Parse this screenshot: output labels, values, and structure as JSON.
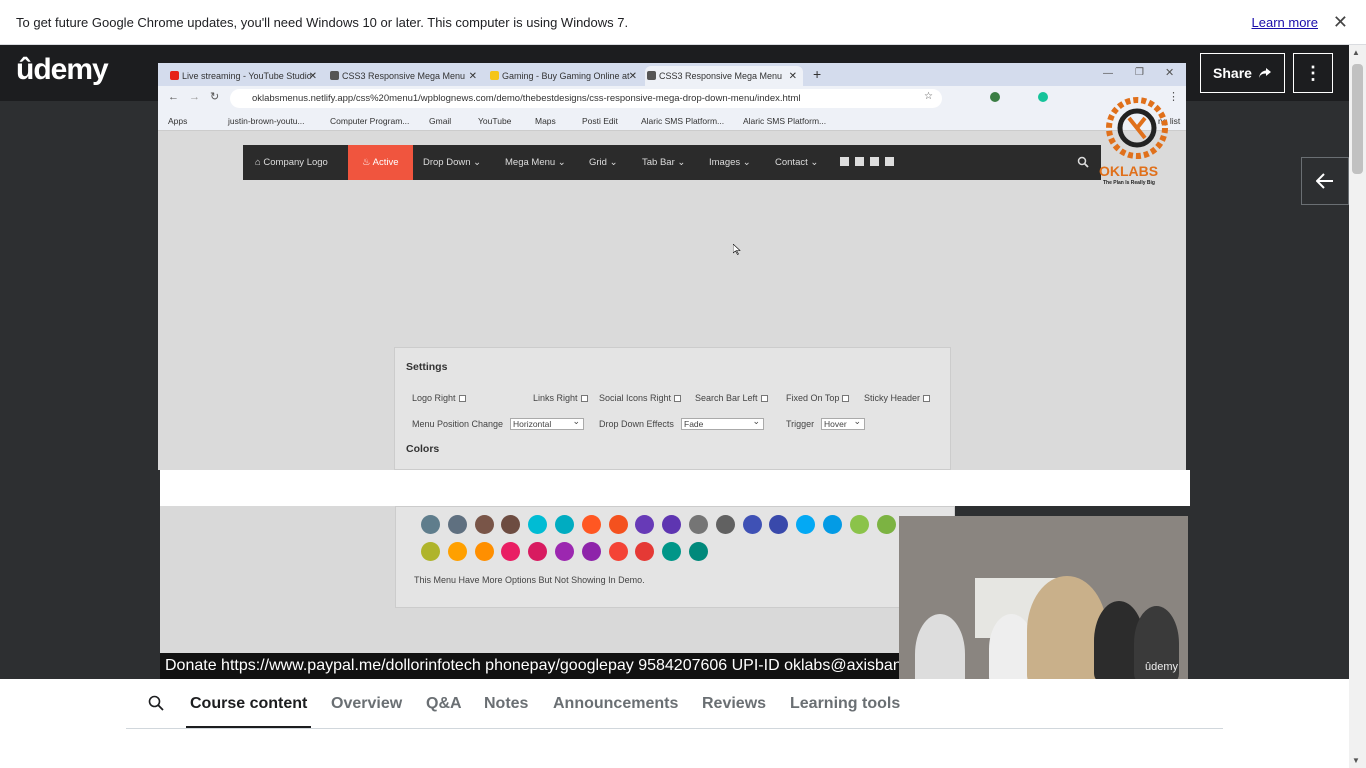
{
  "chrome_notice": {
    "message": "To get future Google Chrome updates, you'll need Windows 10 or later. This computer is using Windows 7.",
    "learn_more": "Learn more",
    "close": "✕"
  },
  "udemy": {
    "logo": "ûdemy",
    "share_label": "Share",
    "more_label": "⋮"
  },
  "inner_browser": {
    "tabs": [
      {
        "title": "Live streaming - YouTube Studio",
        "color": "#e62117"
      },
      {
        "title": "CSS3 Responsive Mega Menu",
        "color": "#555555"
      },
      {
        "title": "Gaming - Buy Gaming Online at",
        "color": "#f5c518"
      },
      {
        "title": "CSS3 Responsive Mega Menu",
        "color": "#555555"
      }
    ],
    "url": "oklabsmenus.netlify.app/css%20menu1/wpblognews.com/demo/thebestdesigns/css-responsive-mega-drop-down-menu/index.html",
    "bookmarks": [
      "Apps",
      "justin-brown-youtu...",
      "Computer Program...",
      "Gmail",
      "YouTube",
      "Maps",
      "Posti Edit",
      "Alaric SMS Platform...",
      "Alaric SMS Platform..."
    ],
    "reading_list": "ng list"
  },
  "site_nav": {
    "logo": "Company Logo",
    "active": "Active",
    "items": [
      "Drop Down ⌄",
      "Mega Menu ⌄",
      "Grid ⌄",
      "Tab Bar ⌄",
      "Images ⌄",
      "Contact ⌄"
    ]
  },
  "settings": {
    "title": "Settings",
    "checkboxes": [
      "Logo Right",
      "Links Right",
      "Social Icons Right",
      "Search Bar Left",
      "Fixed On Top",
      "Sticky Header"
    ],
    "menu_position_label": "Menu Position Change",
    "menu_position_value": "Horizontal",
    "drop_down_label": "Drop Down Effects",
    "drop_down_value": "Fade",
    "trigger_label": "Trigger",
    "trigger_value": "Hover",
    "colors_title": "Colors"
  },
  "colors": {
    "row1": [
      "#5f7d8c",
      "#5f7080",
      "#795548",
      "#6d4c41",
      "#00bcd4",
      "#00acc1",
      "#ff5722",
      "#f4511e",
      "#673ab7",
      "#5e35b1",
      "#757575",
      "#616161",
      "#3f51b5",
      "#3949ab",
      "#03a9f4",
      "#039be5",
      "#8bc34a",
      "#7cb342"
    ],
    "row2": [
      "#afb42b",
      "#ffa000",
      "#ff8f00",
      "#e91e63",
      "#d81b60",
      "#9c27b0",
      "#8e24aa",
      "#f44336",
      "#e53935",
      "#009688",
      "#00897b"
    ],
    "note": "This Menu Have More Options But Not Showing In Demo."
  },
  "oklabs_logo": {
    "name": "OKLABS",
    "tagline": "The Plan Is Really Big"
  },
  "webcam": {
    "watermark": "ûdemy"
  },
  "donate_banner": "Donate https://www.paypal.me/dollorinfotech phonepay/googlepay 9584207606 UPI-ID oklabs@axisbank",
  "course_tabs": {
    "items": [
      "Course content",
      "Overview",
      "Q&A",
      "Notes",
      "Announcements",
      "Reviews",
      "Learning tools"
    ],
    "active": "Course content"
  }
}
